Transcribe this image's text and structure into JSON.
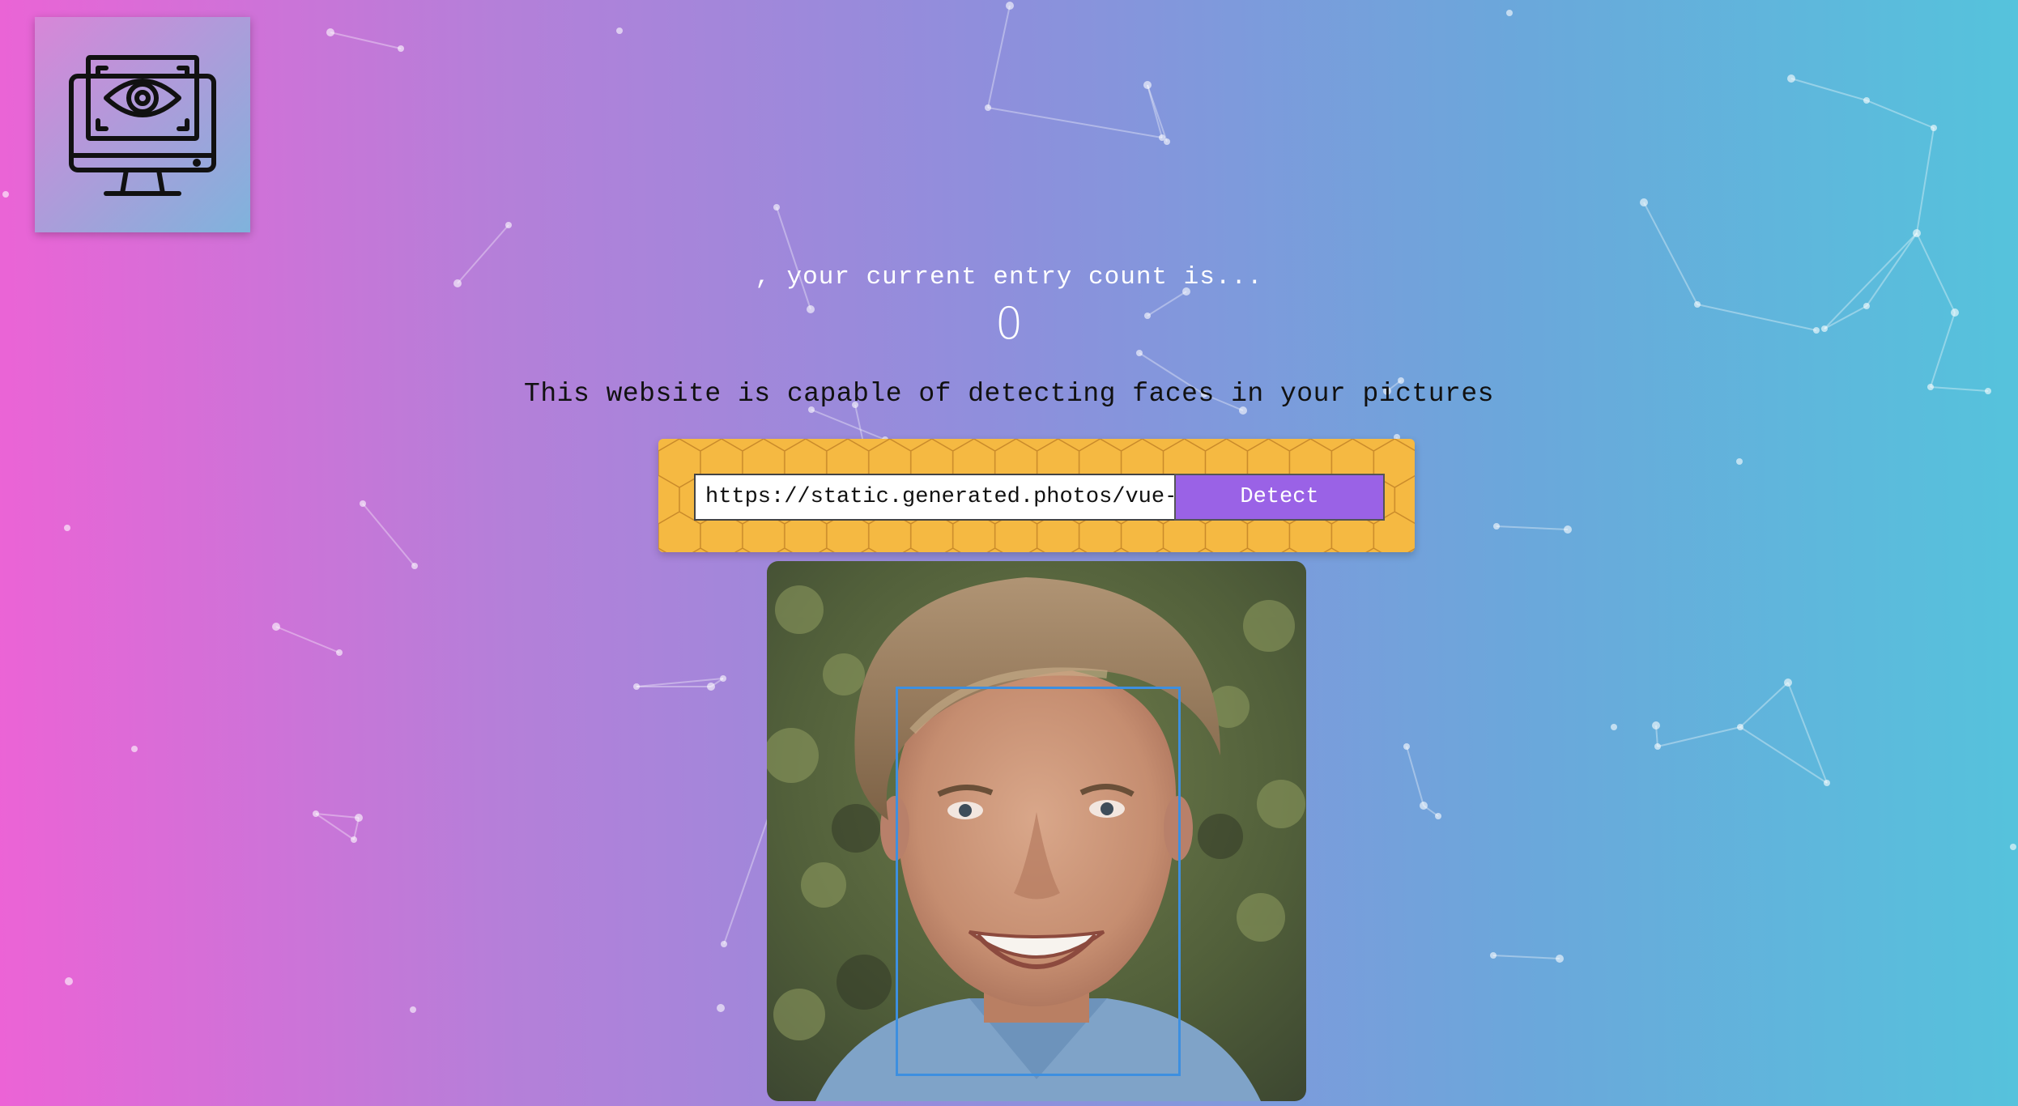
{
  "logo": {
    "icon": "monitor-eye-icon"
  },
  "greeting": ", your current entry count is...",
  "entry_count": "0",
  "tagline": "This website is capable of detecting faces in your pictures",
  "form": {
    "url_value": "https://static.generated.photos/vue-",
    "detect_label": "Detect"
  },
  "result": {
    "image": "detected-face-photo"
  },
  "colors": {
    "gradient_left": "#ec63d6",
    "gradient_right": "#55c3dc",
    "panel": "#f5b942",
    "button": "#9a62e6",
    "face_box": "#3d8fe0"
  }
}
